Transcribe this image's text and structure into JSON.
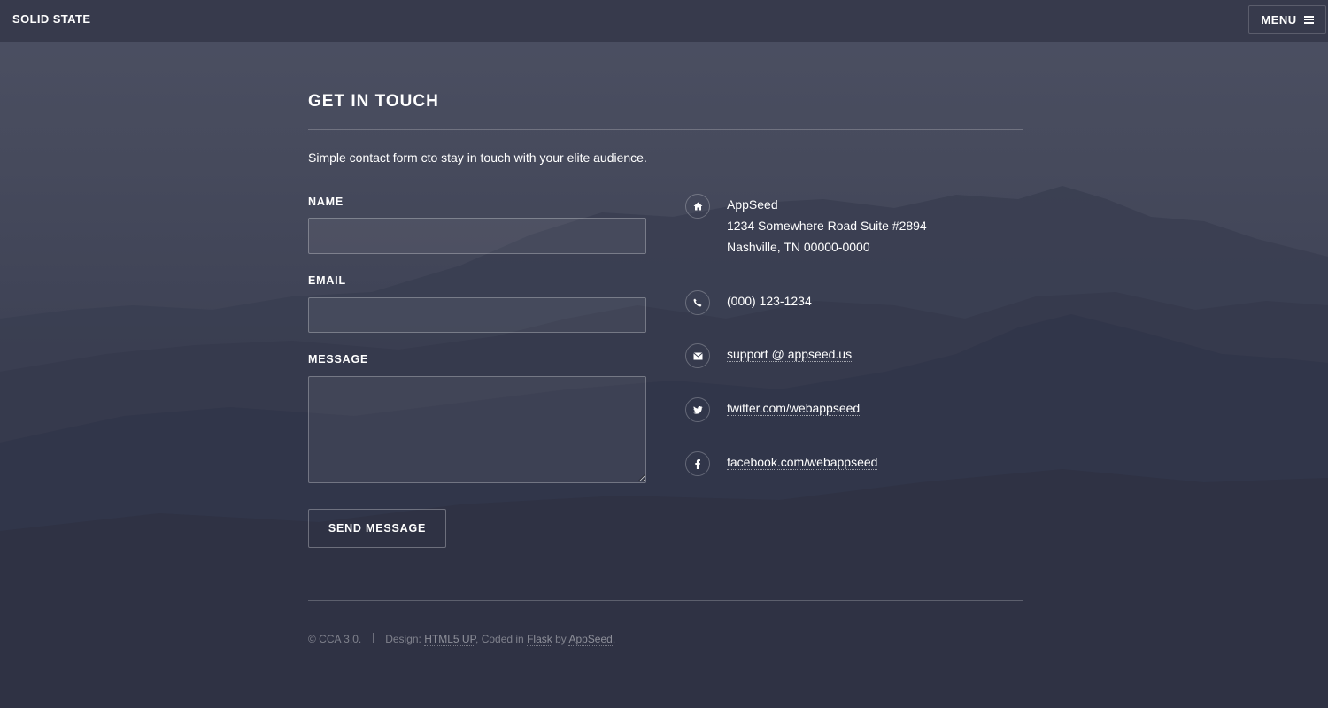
{
  "header": {
    "logo": "SOLID STATE",
    "menu_label": "MENU",
    "menu_icon": "hamburger-icon"
  },
  "contact": {
    "title": "GET IN TOUCH",
    "subtitle": "Simple contact form cto stay in touch with your elite audience.",
    "form": {
      "name_label": "NAME",
      "name_value": "",
      "email_label": "EMAIL",
      "email_value": "",
      "message_label": "MESSAGE",
      "message_value": "",
      "send_label": "SEND MESSAGE"
    },
    "info": {
      "address": {
        "icon": "home-icon",
        "company": "AppSeed",
        "line1": "1234 Somewhere Road Suite #2894",
        "line2": "Nashville, TN 00000-0000"
      },
      "phone": {
        "icon": "phone-icon",
        "text": "(000) 123-1234"
      },
      "email": {
        "icon": "envelope-icon",
        "text": "support @ appseed.us"
      },
      "twitter": {
        "icon": "twitter-icon",
        "text": "twitter.com/webappseed"
      },
      "facebook": {
        "icon": "facebook-icon",
        "text": "facebook.com/webappseed"
      }
    }
  },
  "footer": {
    "copyright": "© CCA 3.0.",
    "design_prefix": "Design: ",
    "design_link": "HTML5 UP",
    "coded_prefix": ", Coded in ",
    "flask_link": "Flask",
    "by_prefix": " by ",
    "appseed_link": "AppSeed",
    "suffix": "."
  },
  "colors": {
    "background": "#2e3142",
    "header": "#36394b",
    "text": "#ffffff"
  }
}
